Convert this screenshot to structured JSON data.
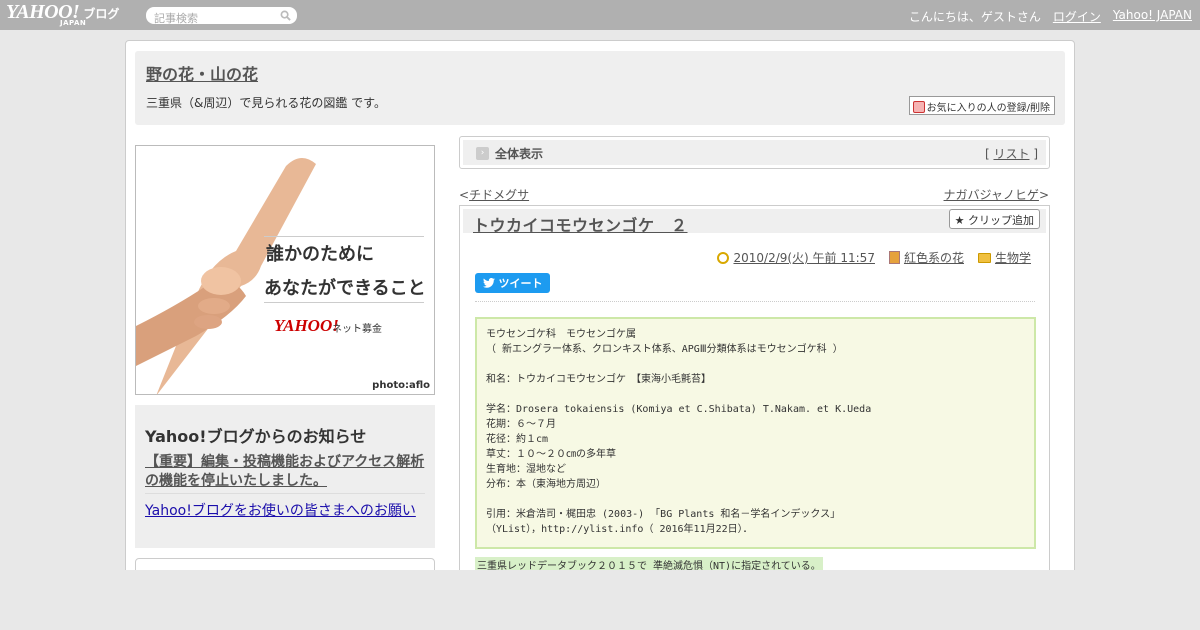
{
  "topbar": {
    "logo": "YAHOO!",
    "logo_sub": "JAPAN",
    "logo_blog": "ブログ",
    "search_placeholder": "記事検索",
    "greeting": "こんにちは、ゲストさん",
    "login": "ログイン",
    "yahoo_japan": "Yahoo! JAPAN"
  },
  "header": {
    "blog_title": "野の花・山の花",
    "description": "三重県（&周辺）で見られる花の図鑑 です。",
    "fav_button": "お気に入りの人の登録/削除"
  },
  "ad": {
    "line1": "誰かのために",
    "line2": "あなたができること",
    "logo": "YAHOO!",
    "logo_sub": "ネット募金",
    "credit": "photo:aflo"
  },
  "notice": {
    "title": "Yahoo!ブログからのお知らせ",
    "link1": "【重要】編集・投稿機能およびアクセス解析の機能を停止いたしました。",
    "link2": "Yahoo!ブログをお使いの皆さまへのお願い"
  },
  "view_bar": {
    "label": "全体表示",
    "list_open": "[ ",
    "list_link": "リスト",
    "list_close": " ]"
  },
  "nav": {
    "prev_marker": "<",
    "prev": "チドメグサ",
    "next": "ナガバジャノヒゲ",
    "next_marker": ">"
  },
  "post": {
    "title": "トウカイコモウセンゴケ　２",
    "clip_button": "クリップ追加",
    "date": "2010/2/9(火) 午前 11:57",
    "category": "紅色系の花",
    "folder": "生物学",
    "tweet": "ツイート",
    "content_lines": [
      "モウセンゴケ科　モウセンゴケ属",
      "（ 新エングラー体系、クロンキスト体系、APGⅢ分類体系はモウセンゴケ科 ）",
      "",
      "和名：トウカイコモウセンゴケ　【東海小毛氈苔】",
      "",
      "学名：Drosera tokaiensis (Komiya et C.Shibata) T.Nakam. et K.Ueda",
      "花期：６～７月",
      "花径：約１cm",
      "草丈：１０～２０㎝の多年草",
      "生育地：湿地など",
      "分布：本（東海地方周辺）",
      "",
      "引用：米倉浩司・梶田忠 (2003-) 「BG Plants 和名－学名インデックス」",
      "（YList），http://ylist.info（ 2016年11月22日）．"
    ],
    "redlist_note": "三重県レッドデータブック２０１５で 準絶滅危惧（NT)に指定されている。"
  },
  "colors": {
    "topbar": "#b0b0b0",
    "tweet": "#1d9bf0",
    "content_bg": "#f7f9e4",
    "content_border": "#cde8a8"
  }
}
